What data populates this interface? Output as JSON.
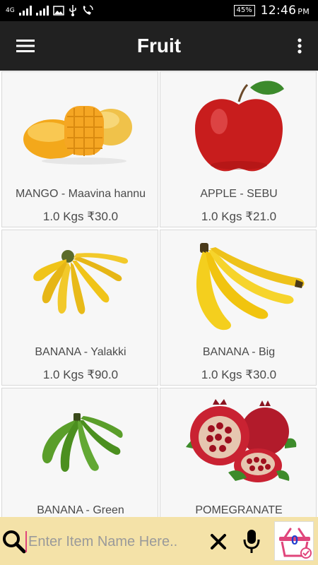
{
  "status_bar": {
    "network": "4G",
    "battery": "45%",
    "time": "12:46",
    "ampm": "PM"
  },
  "app_bar": {
    "title": "Fruit",
    "menu_icon": "hamburger-menu-icon",
    "overflow_icon": "more-vert-icon"
  },
  "products": [
    {
      "name": "MANGO - Maavina hannu",
      "price": "1.0 Kgs ₹30.0",
      "image": "mango"
    },
    {
      "name": "APPLE - SEBU",
      "price": "1.0 Kgs ₹21.0",
      "image": "apple"
    },
    {
      "name": "BANANA - Yalakki",
      "price": "1.0 Kgs ₹90.0",
      "image": "banana-yalakki"
    },
    {
      "name": "BANANA - Big",
      "price": "1.0 Kgs ₹30.0",
      "image": "banana-big"
    },
    {
      "name": "BANANA - Green",
      "price": "",
      "image": "banana-green"
    },
    {
      "name": "POMEGRANATE",
      "price": "",
      "image": "pomegranate"
    }
  ],
  "search": {
    "placeholder": "Enter Item Name Here..",
    "value": ""
  },
  "cart": {
    "count": "0",
    "icon": "shopping-basket-icon"
  },
  "colors": {
    "app_bar": "#212121",
    "search_bar": "#f4e2a8",
    "cart_count": "#1f3fcf",
    "cart_icon": "#e0457b"
  }
}
